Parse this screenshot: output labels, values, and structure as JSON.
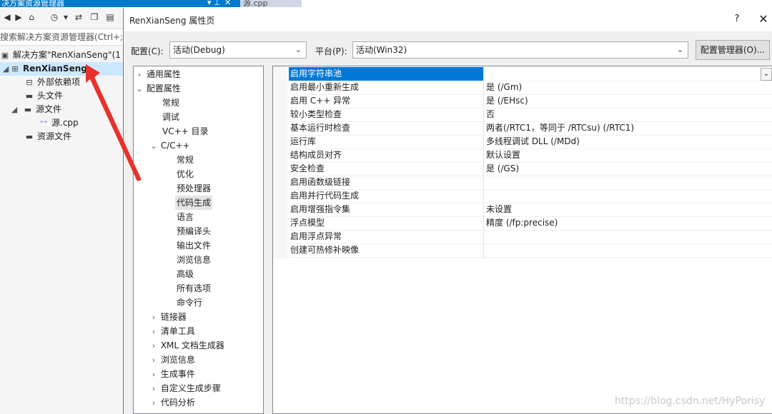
{
  "solution_explorer": {
    "title": "决方案资源管理器",
    "search_placeholder": "搜索解决方案资源管理器(Ctrl+;)",
    "tree": [
      {
        "label": "解决方案\"RenXianSeng\"(1",
        "icon": "solution-icon"
      },
      {
        "label": "RenXianSeng",
        "icon": "project-icon"
      },
      {
        "label": "外部依赖项",
        "icon": "external-deps-icon"
      },
      {
        "label": "头文件",
        "icon": "folder-icon"
      },
      {
        "label": "源文件",
        "icon": "folder-icon"
      },
      {
        "label": "源.cpp",
        "icon": "cpp-file-icon"
      },
      {
        "label": "资源文件",
        "icon": "folder-icon"
      }
    ]
  },
  "editor_tab": {
    "label": "源.cpp"
  },
  "dialog": {
    "title": "RenXianSeng 属性页",
    "help_glyph": "?",
    "close_glyph": "✕",
    "config_label": "配置(C):",
    "config_value": "活动(Debug)",
    "platform_label": "平台(P):",
    "platform_value": "活动(Win32)",
    "config_manager_label": "配置管理器(O)..."
  },
  "categories": [
    {
      "label": "通用属性",
      "chevron": "›"
    },
    {
      "label": "配置属性",
      "chevron": "⌄"
    },
    {
      "label": "常规",
      "chevron": ""
    },
    {
      "label": "调试",
      "chevron": ""
    },
    {
      "label": "VC++ 目录",
      "chevron": ""
    },
    {
      "label": "C/C++",
      "chevron": "⌄"
    },
    {
      "label": "常规",
      "chevron": ""
    },
    {
      "label": "优化",
      "chevron": ""
    },
    {
      "label": "预处理器",
      "chevron": ""
    },
    {
      "label": "代码生成",
      "chevron": ""
    },
    {
      "label": "语言",
      "chevron": ""
    },
    {
      "label": "预编译头",
      "chevron": ""
    },
    {
      "label": "输出文件",
      "chevron": ""
    },
    {
      "label": "浏览信息",
      "chevron": ""
    },
    {
      "label": "高级",
      "chevron": ""
    },
    {
      "label": "所有选项",
      "chevron": ""
    },
    {
      "label": "命令行",
      "chevron": ""
    },
    {
      "label": "链接器",
      "chevron": "›"
    },
    {
      "label": "清单工具",
      "chevron": "›"
    },
    {
      "label": "XML 文档生成器",
      "chevron": "›"
    },
    {
      "label": "浏览信息",
      "chevron": "›"
    },
    {
      "label": "生成事件",
      "chevron": "›"
    },
    {
      "label": "自定义生成步骤",
      "chevron": "›"
    },
    {
      "label": "代码分析",
      "chevron": "›"
    }
  ],
  "properties": [
    {
      "name": "启用字符串池",
      "value": ""
    },
    {
      "name": "启用最小重新生成",
      "value": "是 (/Gm)"
    },
    {
      "name": "启用 C++ 异常",
      "value": "是 (/EHsc)"
    },
    {
      "name": "较小类型检查",
      "value": "否"
    },
    {
      "name": "基本运行时检查",
      "value": "两者(/RTC1，等同于 /RTCsu) (/RTC1)"
    },
    {
      "name": "运行库",
      "value": "多线程调试 DLL (/MDd)"
    },
    {
      "name": "结构成员对齐",
      "value": "默认设置"
    },
    {
      "name": "安全检查",
      "value": "是 (/GS)"
    },
    {
      "name": "启用函数级链接",
      "value": ""
    },
    {
      "name": "启用并行代码生成",
      "value": ""
    },
    {
      "name": "启用增强指令集",
      "value": "未设置"
    },
    {
      "name": "浮点模型",
      "value": "精度 (/fp:precise)"
    },
    {
      "name": "启用浮点异常",
      "value": ""
    },
    {
      "name": "创建可热修补映像",
      "value": ""
    }
  ],
  "watermark": "https://blog.csdn.net/HyPorisy",
  "colors": {
    "accent": "#007acc",
    "selection": "#0078d7",
    "annotation_arrow": "#e8312a"
  }
}
